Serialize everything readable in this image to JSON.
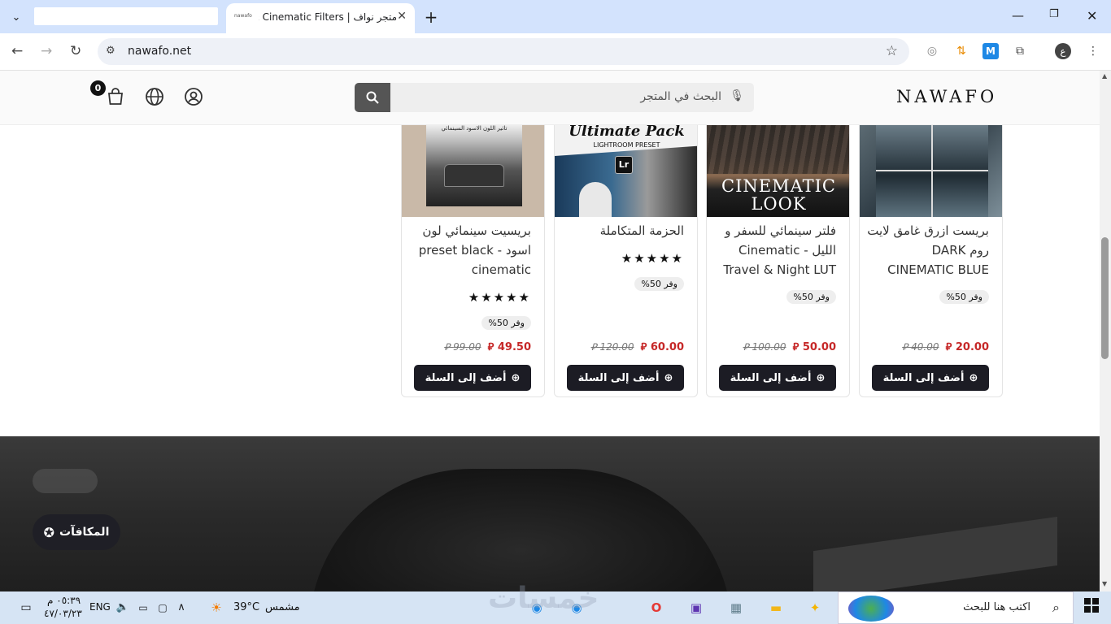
{
  "browser": {
    "tab_title": "متجر نواف | Cinematic Filters &",
    "url": "nawafo.net",
    "profile_letter": "ع"
  },
  "site": {
    "logo": "NAWAFO",
    "search_placeholder": "البحث في المتجر",
    "cart_count": "0"
  },
  "products": [
    {
      "name": "بريست ازرق غامق لايت روم DARK CINEMATIC BLUE",
      "badge": "وفر 50%",
      "price_new": "20.00 ⃁",
      "price_old": "40.00 ⃁",
      "button": "أضف إلى السلة",
      "stars": ""
    },
    {
      "name": "فلتر سينمائي للسفر و الليل - Cinematic Travel & Night LUT",
      "badge": "وفر 50%",
      "price_new": "50.00 ⃁",
      "price_old": "100.00 ⃁",
      "button": "أضف إلى السلة",
      "stars": "",
      "img_text": "CINEMATIC LOOK"
    },
    {
      "name": "الحزمة المتكاملة",
      "badge": "وفر 50%",
      "price_new": "60.00 ⃁",
      "price_old": "120.00 ⃁",
      "button": "أضف إلى السلة",
      "stars": "★★★★★",
      "img_text": "Ultimate Pack",
      "img_sub": "LIGHTROOM PRESET",
      "img_badge": "Lr"
    },
    {
      "name": "بريسيت سينمائي لون اسود - preset black cinematic",
      "badge": "وفر 50%",
      "price_new": "49.50 ⃁",
      "price_old": "99.00 ⃁",
      "button": "أضف إلى السلة",
      "stars": "★★★★★",
      "img_text": "تأثير اللون الاسود السينمائي"
    }
  ],
  "rewards_label": "المكافآت",
  "taskbar": {
    "search_placeholder": "اكتب هنا للبحث",
    "weather_label": "مشمس",
    "temperature": "39°C",
    "language": "ENG",
    "time": "٠٥:٣٩ م",
    "date": "٤٧/٠٣/٢٣",
    "watermark": "خمسات"
  },
  "colors": {
    "tab_bar": "#d3e3fd",
    "price_red": "#c62828",
    "button_dark": "#1c1c24",
    "taskbar": "#d6e4f4"
  }
}
